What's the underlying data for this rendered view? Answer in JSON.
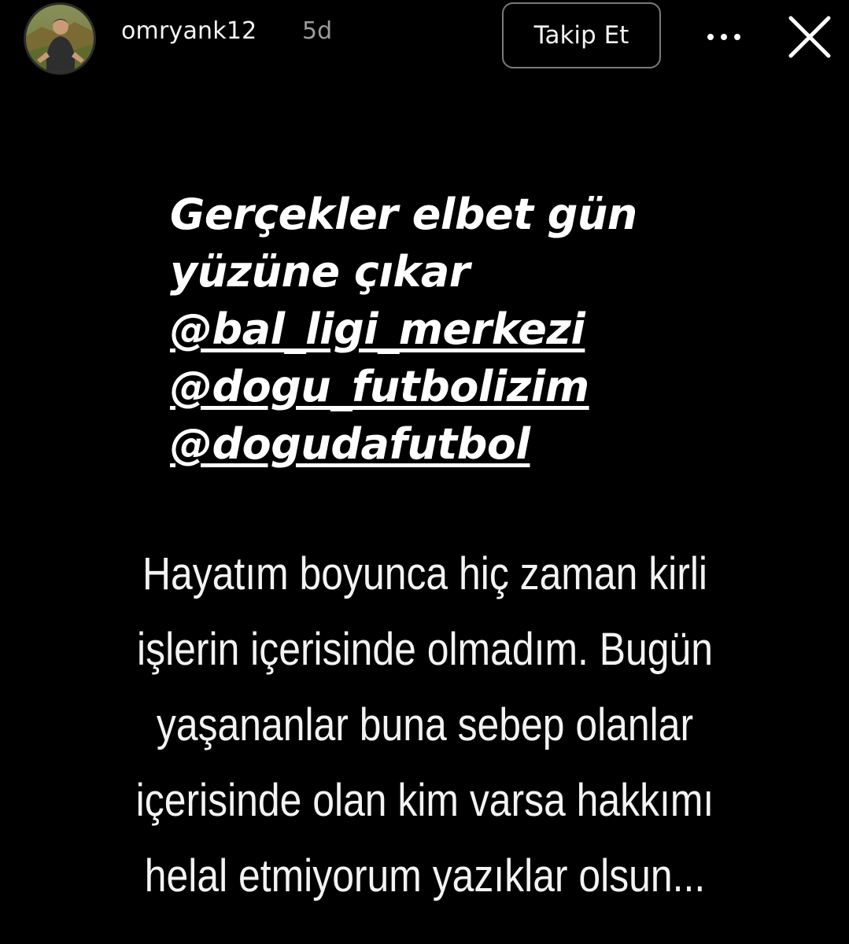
{
  "header": {
    "username": "omryank12",
    "time": "5d",
    "follow_label": "Takip Et",
    "more_icon": "more-horizontal-icon",
    "close_icon": "close-icon"
  },
  "caption": {
    "lines": [
      "Gerçekler elbet gün",
      "yüzüne çıkar"
    ],
    "mentions": [
      "@bal_ligi_merkezi",
      "@dogu_futbolizim",
      "@dogudafutbol"
    ]
  },
  "statement": {
    "lines": [
      "Hayatım boyunca hiç zaman kirli",
      "işlerin içerisinde olmadım. Bugün",
      "yaşananlar  buna sebep olanlar",
      "içerisinde olan kim varsa hakkımı",
      "helal etmiyorum yazıklar olsun..."
    ]
  },
  "colors": {
    "background": "#000000",
    "text": "#ffffff",
    "muted": "#9b9b9b",
    "button_border": "#7a7a7a"
  }
}
